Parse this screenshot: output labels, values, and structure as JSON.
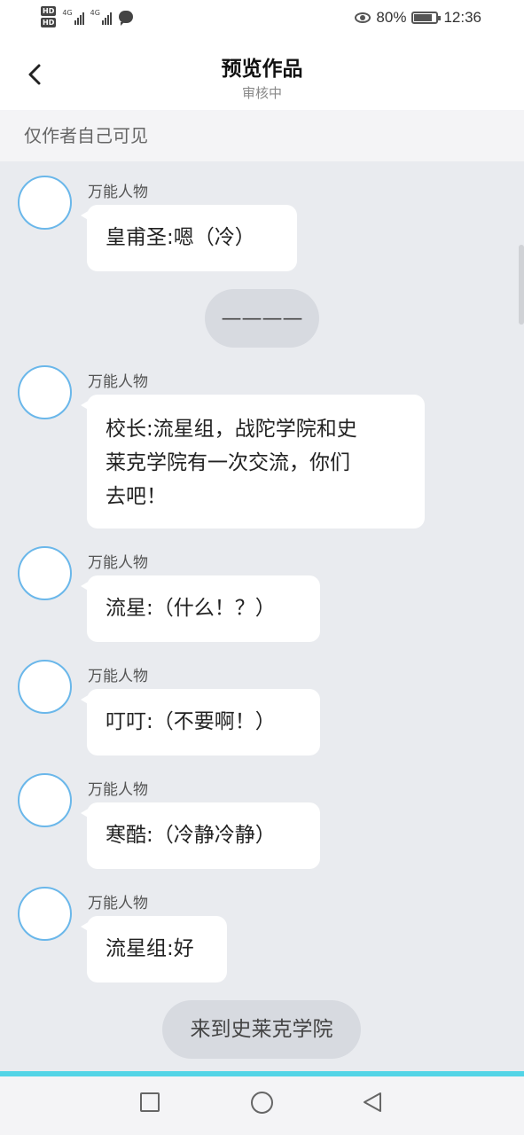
{
  "status_bar": {
    "hd1": "HD",
    "hd2": "HD",
    "sig1": "4G",
    "sig2": "4G",
    "battery_pct": "80%",
    "battery_level": 0.8,
    "time": "12:36"
  },
  "header": {
    "title": "预览作品",
    "subtitle": "审核中"
  },
  "notice": "仅作者自己可见",
  "messages": [
    {
      "speaker": "万能人物",
      "text": "皇甫圣:嗯（冷）"
    },
    {
      "narration": "————"
    },
    {
      "speaker": "万能人物",
      "text": "校长:流星组，战陀学院和史\n莱克学院有一次交流，你们\n去吧！"
    },
    {
      "speaker": "万能人物",
      "text": "流星:（什么！？）"
    },
    {
      "speaker": "万能人物",
      "text": "叮叮:（不要啊！）"
    },
    {
      "speaker": "万能人物",
      "text": "寒酷:（冷静冷静）"
    },
    {
      "speaker": "万能人物",
      "text": "流星组:好"
    },
    {
      "narration": "来到史莱克学院"
    }
  ],
  "colors": {
    "background": "#e9ebef",
    "avatar_border": "#6ab7ea",
    "accent_line": "#53d4e6",
    "narration_pill": "#d7dae0"
  },
  "icons": {
    "back": "chevron-left-icon",
    "eye": "eye-icon",
    "battery": "battery-icon",
    "recent": "square-icon",
    "home": "circle-icon",
    "system_back": "triangle-left-icon"
  }
}
